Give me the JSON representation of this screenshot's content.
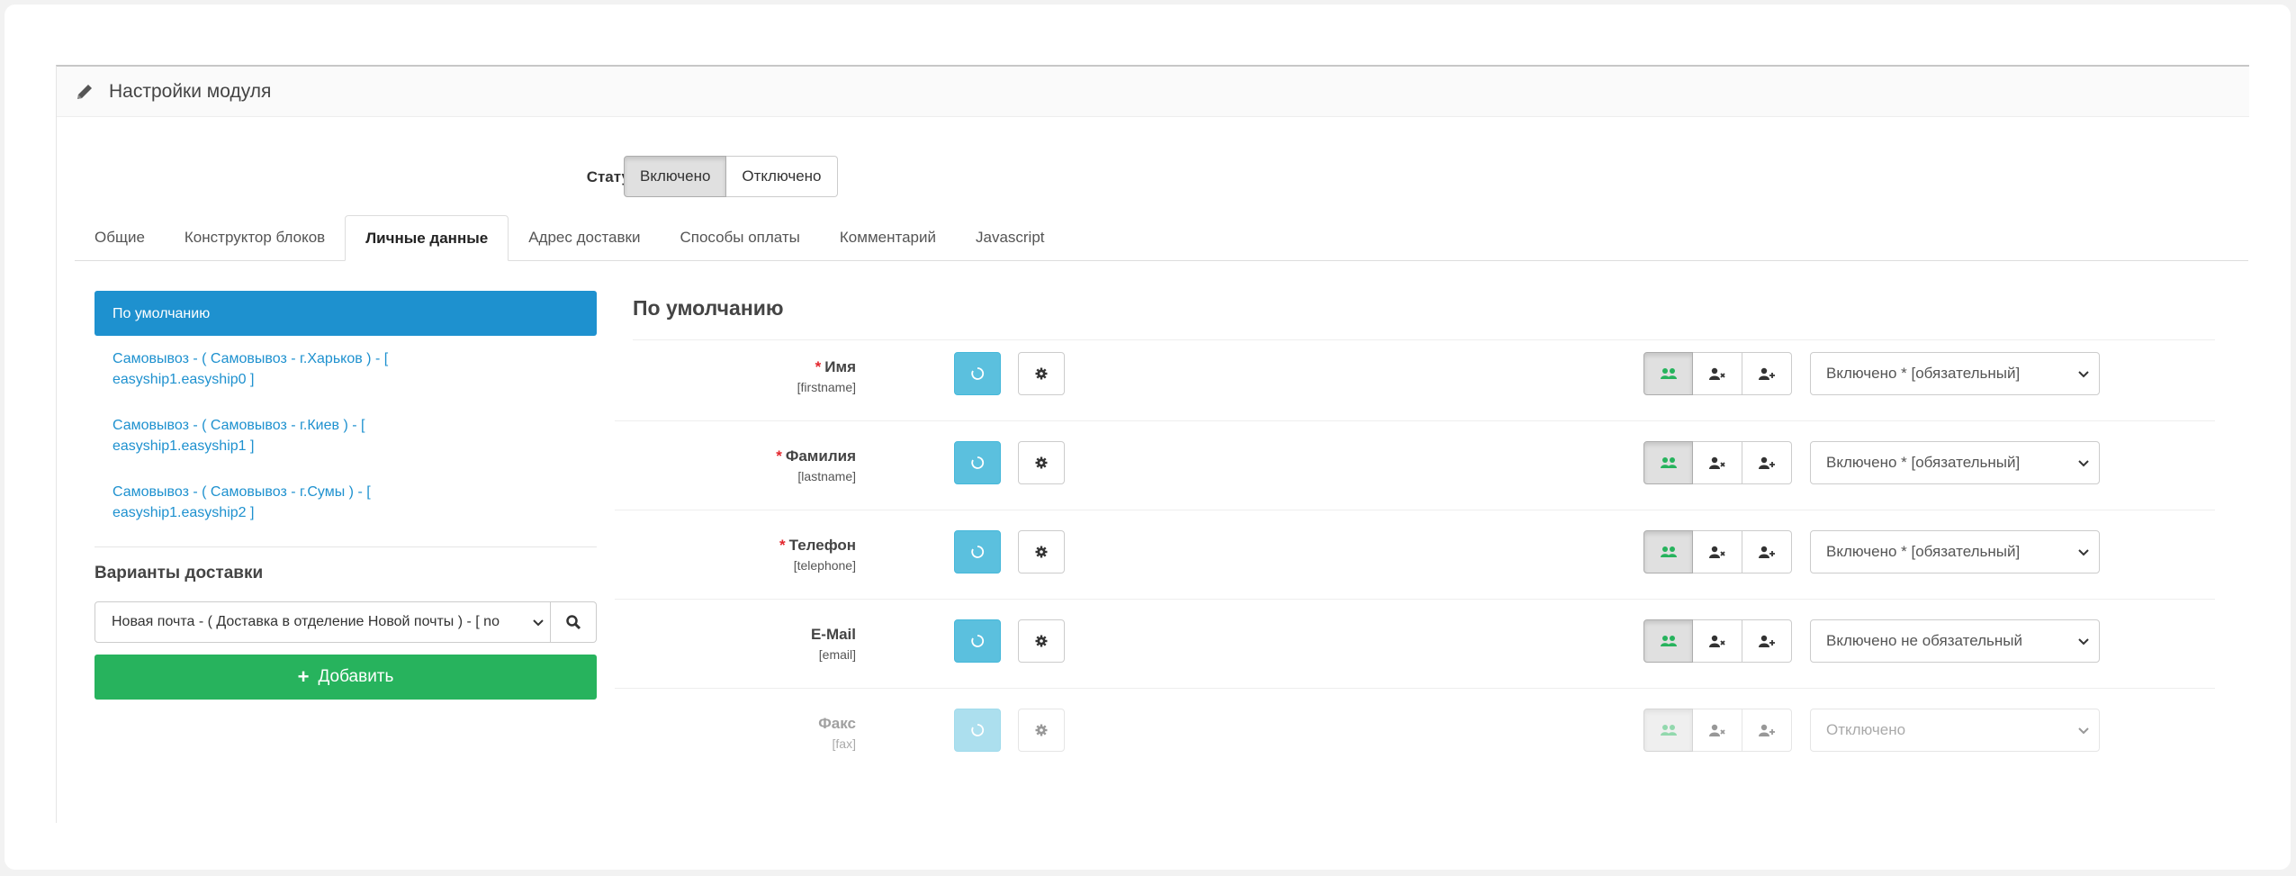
{
  "panel": {
    "title": "Настройки модуля"
  },
  "status": {
    "label": "Статус",
    "options": [
      "Включено",
      "Отключено"
    ],
    "selected": "Включено"
  },
  "tabs": [
    "Общие",
    "Конструктор блоков",
    "Личные данные",
    "Адрес доставки",
    "Способы оплаты",
    "Комментарий",
    "Javascript"
  ],
  "active_tab": "Личные данные",
  "sidebar": {
    "items": [
      {
        "label": "По умолчанию",
        "active": true
      },
      {
        "label_line1": "Самовывоз - ( Самовывоз - г.Харьков ) - [",
        "label_line2": "easyship1.easyship0 ]"
      },
      {
        "label_line1": "Самовывоз - ( Самовывоз - г.Киев ) - [",
        "label_line2": "easyship1.easyship1 ]"
      },
      {
        "label_line1": "Самовывоз - ( Самовывоз - г.Сумы ) - [",
        "label_line2": "easyship1.easyship2 ]"
      }
    ],
    "delivery_title": "Варианты доставки",
    "delivery_select": "Новая почта - ( Доставка в отделение Новой почты ) - [ no",
    "add_button": "Добавить"
  },
  "main": {
    "title": "По умолчанию",
    "fields": [
      {
        "name": "Имя",
        "key": "[firstname]",
        "required": "*",
        "select": "Включено * [обязательный]"
      },
      {
        "name": "Фамилия",
        "key": "[lastname]",
        "required": "*",
        "select": "Включено * [обязательный]"
      },
      {
        "name": "Телефон",
        "key": "[telephone]",
        "required": "*",
        "select": "Включено * [обязательный]"
      },
      {
        "name": "E-Mail",
        "key": "[email]",
        "required": "",
        "select": "Включено не обязательный"
      },
      {
        "name": "Факс",
        "key": "[fax]",
        "required": "",
        "select": "Отключено",
        "disabled": true
      }
    ]
  },
  "colors": {
    "primary": "#1e91cf",
    "success": "#27b35d",
    "info": "#5bc0de",
    "required": "#e3262d"
  }
}
